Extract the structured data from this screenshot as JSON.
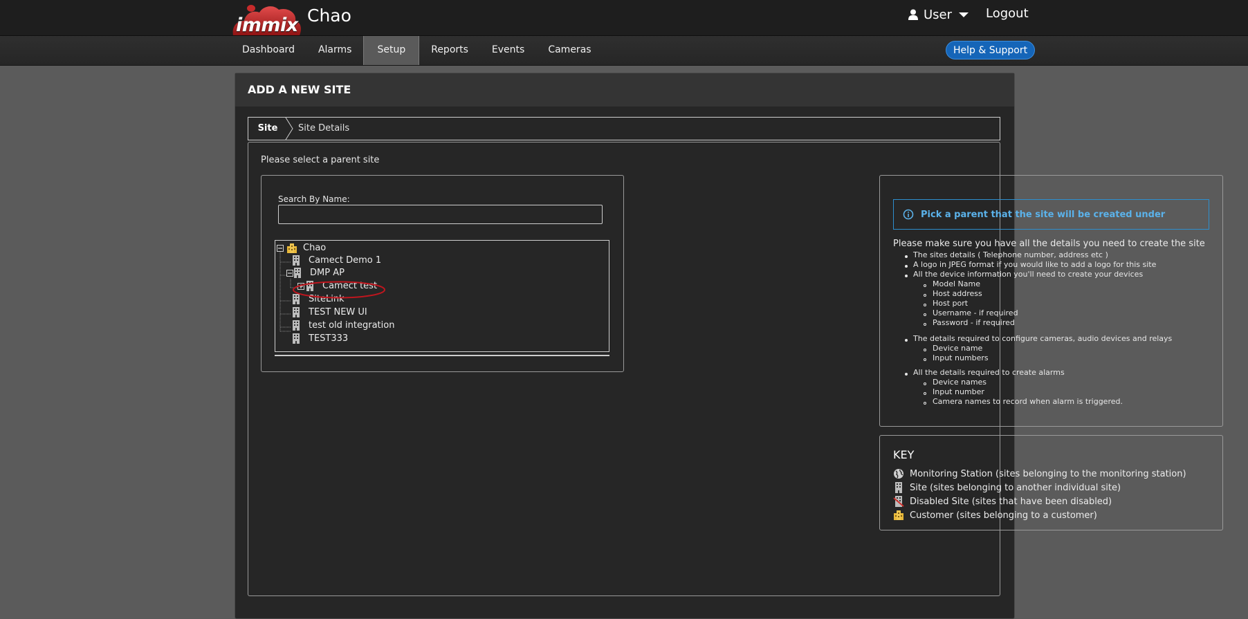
{
  "header": {
    "logo_text": "immix",
    "site_title": "Chao",
    "user_label": "User",
    "logout_label": "Logout"
  },
  "nav": {
    "items": [
      {
        "label": "Dashboard",
        "active": false
      },
      {
        "label": "Alarms",
        "active": false
      },
      {
        "label": "Setup",
        "active": true
      },
      {
        "label": "Reports",
        "active": false
      },
      {
        "label": "Events",
        "active": false
      },
      {
        "label": "Cameras",
        "active": false
      }
    ],
    "help_label": "Help & Support"
  },
  "page": {
    "title": "ADD A NEW SITE",
    "breadcrumb": {
      "site": "Site",
      "details": "Site Details"
    },
    "prompt": "Please select a parent site"
  },
  "search": {
    "label": "Search By Name:",
    "value": "",
    "placeholder": ""
  },
  "tree": {
    "nodes": [
      {
        "label": "Chao",
        "icon": "customer-icon",
        "expander": "minus"
      },
      {
        "label": "Camect Demo 1",
        "icon": "site-icon",
        "expander": "none"
      },
      {
        "label": "DMP AP",
        "icon": "site-icon",
        "expander": "minus"
      },
      {
        "label": "Camect test",
        "icon": "site-icon",
        "expander": "plus",
        "highlighted": true
      },
      {
        "label": "SiteLink",
        "icon": "site-icon",
        "expander": "none"
      },
      {
        "label": "TEST NEW UI",
        "icon": "site-icon",
        "expander": "none"
      },
      {
        "label": "test old integration",
        "icon": "site-icon",
        "expander": "none"
      },
      {
        "label": "TEST333",
        "icon": "site-icon",
        "expander": "none"
      }
    ]
  },
  "info": {
    "alert": "Pick a parent that the site will be created under",
    "heading": "Please make sure you have all the details you need to create the site",
    "items": [
      {
        "text": "The sites details ( Telephone number, address etc )",
        "sub": []
      },
      {
        "text": "A logo in JPEG format if you would like to add a logo for this site",
        "sub": []
      },
      {
        "text": "All the device information you'll need to create your devices",
        "sub": [
          "Model Name",
          "Host address",
          "Host port",
          "Username - if required",
          "Password - if required"
        ]
      },
      {
        "text": "The details required to configure cameras, audio devices and relays",
        "sub": [
          "Device name",
          "Input numbers"
        ]
      },
      {
        "text": "All the details required to create alarms",
        "sub": [
          "Device names",
          "Input number",
          "Camera names to record when alarm is triggered."
        ]
      }
    ]
  },
  "key": {
    "title": "KEY",
    "items": [
      {
        "icon": "globe-icon",
        "text": "Monitoring Station (sites belonging to the monitoring station)"
      },
      {
        "icon": "site-icon",
        "text": "Site (sites belonging to another individual site)"
      },
      {
        "icon": "disabled-site-icon",
        "text": "Disabled Site (sites that have been disabled)"
      },
      {
        "icon": "customer-icon",
        "text": "Customer (sites belonging to a customer)"
      }
    ]
  },
  "colors": {
    "accent_blue": "#1565b8",
    "alert_text": "#5bb2ea",
    "highlight_red": "#c0161e",
    "customer_yellow": "#e8b83a"
  }
}
